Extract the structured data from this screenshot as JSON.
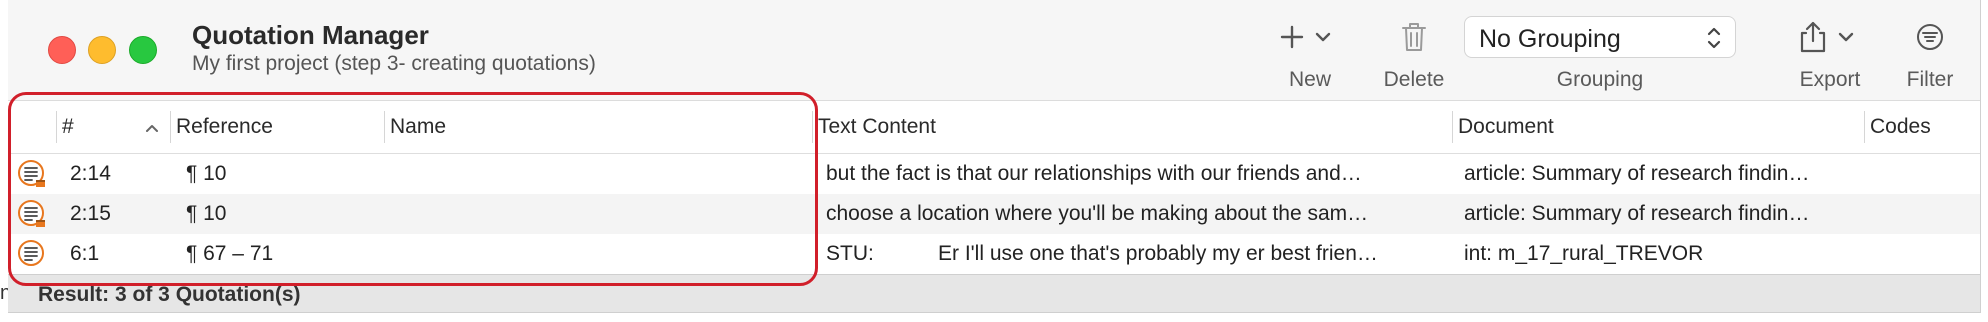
{
  "window": {
    "title": "Quotation Manager",
    "subtitle": "My first project (step 3- creating quotations)"
  },
  "toolbar": {
    "new_label": "New",
    "delete_label": "Delete",
    "grouping_label": "Grouping",
    "grouping_value": "No Grouping",
    "export_label": "Export",
    "filter_label": "Filter"
  },
  "table": {
    "columns": [
      "#",
      "Reference",
      "Name",
      "Text Content",
      "Document",
      "Codes"
    ],
    "sort_column": "#",
    "sort_direction": "ascending",
    "rows": [
      {
        "id": "2:14",
        "reference": "¶ 10",
        "name": "",
        "text_content": "but the fact is that our relationships with our friends and…",
        "document": "article: Summary of research findin…",
        "codes": "",
        "icon": "quotation-note-icon"
      },
      {
        "id": "2:15",
        "reference": "¶ 10",
        "name": "",
        "text_content": "choose a location where you'll be making about the sam…",
        "document": "article: Summary of research findin…",
        "codes": "",
        "icon": "quotation-note-icon"
      },
      {
        "id": "6:1",
        "reference": "¶ 67 – 71",
        "name": "",
        "text_content_speaker": "STU:",
        "text_content": "Er I'll use one that's probably my er best frien…",
        "document": "int: m_17_rural_TREVOR",
        "codes": "",
        "icon": "quotation-icon"
      }
    ]
  },
  "status": {
    "result": "Result: 3 of 3 Quotation(s)",
    "edge_char": "n"
  },
  "colors": {
    "highlight": "#d11f2a",
    "icon_orange": "#e8771e",
    "close": "#ff5f57",
    "minimize": "#febc2e",
    "maximize": "#28c840"
  }
}
